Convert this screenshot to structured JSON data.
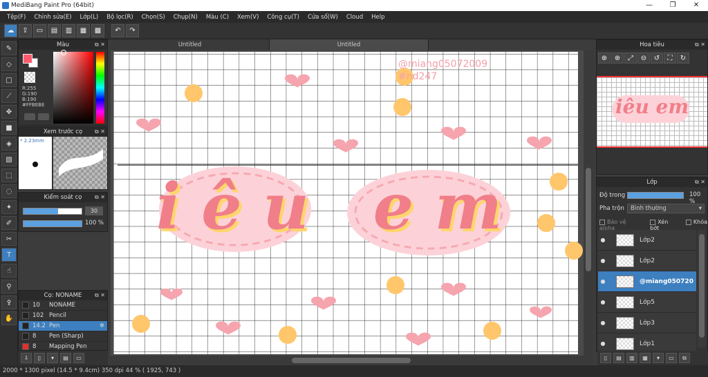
{
  "window": {
    "title": "MediBang Paint Pro (64bit)",
    "minimize": "—",
    "maximize": "❐",
    "close": "✕"
  },
  "menu": [
    "Tệp(F)",
    "Chỉnh sửa(E)",
    "Lớp(L)",
    "Bộ lọc(R)",
    "Chọn(S)",
    "Chụp(N)",
    "Màu (C)",
    "Xem(V)",
    "Công cụ(T)",
    "Cửa sổ(W)",
    "Cloud",
    "Help"
  ],
  "tabs": [
    "Untitled",
    "Untitled"
  ],
  "panels": {
    "color": {
      "title": "Màu",
      "r": "R:255",
      "g": "G:190",
      "b": "B:190",
      "hex": "#FFBEBE",
      "fg": "#ff5a6e",
      "bg": "#ffffff"
    },
    "brush_preview": {
      "title": "Xem trước cọ",
      "size": "* 2.23mm"
    },
    "brush_control": {
      "title": "Kiểm soát cọ",
      "size_val": "30",
      "opacity_val": "100 %",
      "opacity": 1.0,
      "size_frac": 0.6
    },
    "brushes": {
      "title": "Cọ: NONAME",
      "items": [
        {
          "size": "10",
          "name": "NONAME",
          "selected": false,
          "color": "#222"
        },
        {
          "size": "102",
          "name": "Pencil",
          "selected": false,
          "color": "#222"
        },
        {
          "size": "14.2",
          "name": "Pen",
          "selected": true,
          "color": "#222"
        },
        {
          "size": "8",
          "name": "Pen (Sharp)",
          "selected": false,
          "color": "#222"
        },
        {
          "size": "8",
          "name": "Mapping Pen",
          "selected": false,
          "color": "#e03030"
        }
      ]
    },
    "navigator": {
      "title": "Hoa tiêu"
    },
    "layers": {
      "title": "Lớp",
      "opacity_label": "Độ trong",
      "opacity_val": "100 %",
      "opacity": 1.0,
      "blend_label": "Pha trộn",
      "blend_val": "Bình thường",
      "protect_alpha": "Bảo vệ alpha",
      "clip": "Xén bớt",
      "lock": "Khóa",
      "items": [
        {
          "name": "Lớp2",
          "selected": false
        },
        {
          "name": "Lớp2",
          "selected": false
        },
        {
          "name": "@miang050720",
          "selected": true
        },
        {
          "name": "Lớp5",
          "selected": false
        },
        {
          "name": "Lớp3",
          "selected": false
        },
        {
          "name": "Lớp1",
          "selected": false
        }
      ]
    }
  },
  "canvas": {
    "text_main": "iêu em",
    "watermark1": "@miang05072009",
    "watermark2": "#nd247"
  },
  "status": "2000 * 1300 pixel   (14.5 * 9.4cm)   350 dpi   44 %   ( 1925, 743 )",
  "colors": {
    "accent": "#3d7fbf",
    "heart": "#f07f8a",
    "dot": "#ffc66b"
  }
}
